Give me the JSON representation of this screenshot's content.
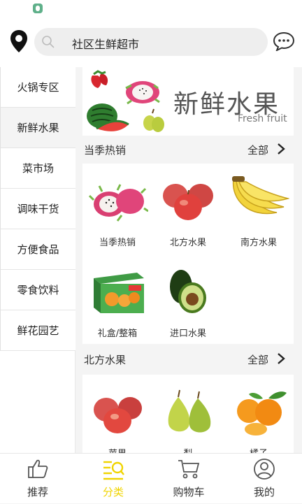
{
  "header": {
    "search_text": "社区生鲜超市",
    "location_icon": "location-pin-icon",
    "message_icon": "chat-bubble-icon"
  },
  "sidebar": {
    "items": [
      {
        "label": "火锅专区",
        "active": false
      },
      {
        "label": "新鲜水果",
        "active": true
      },
      {
        "label": "菜市场",
        "active": false
      },
      {
        "label": "调味干货",
        "active": false
      },
      {
        "label": "方便食品",
        "active": false
      },
      {
        "label": "零食饮料",
        "active": false
      },
      {
        "label": "鲜花园艺",
        "active": false
      }
    ]
  },
  "banner": {
    "title": "新鲜水果",
    "subtitle": "Fresh fruit"
  },
  "sections": [
    {
      "title": "当季热销",
      "more": "全部",
      "items": [
        {
          "label": "当季热销",
          "icon": "dragon-fruit-icon"
        },
        {
          "label": "北方水果",
          "icon": "apple-icon"
        },
        {
          "label": "南方水果",
          "icon": "banana-icon"
        },
        {
          "label": "礼盒/整箱",
          "icon": "gift-box-icon"
        },
        {
          "label": "进口水果",
          "icon": "avocado-icon"
        }
      ]
    },
    {
      "title": "北方水果",
      "more": "全部",
      "items": [
        {
          "label": "苹果",
          "icon": "apple-icon"
        },
        {
          "label": "梨",
          "icon": "pear-icon"
        },
        {
          "label": "橘子",
          "icon": "orange-icon"
        }
      ]
    }
  ],
  "tabbar": {
    "items": [
      {
        "label": "推荐",
        "icon": "thumbs-up-icon",
        "active": false
      },
      {
        "label": "分类",
        "icon": "category-search-icon",
        "active": true
      },
      {
        "label": "购物车",
        "icon": "shopping-cart-icon",
        "active": false
      },
      {
        "label": "我的",
        "icon": "user-profile-icon",
        "active": false
      }
    ]
  },
  "colors": {
    "accent": "#f0d400",
    "background": "#f4f4f4"
  }
}
